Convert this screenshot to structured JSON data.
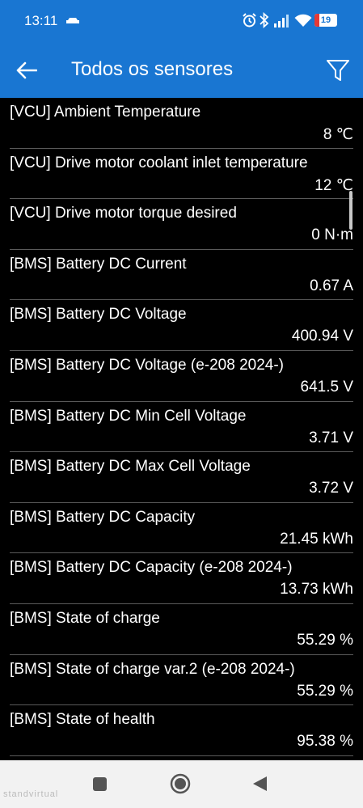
{
  "status_bar": {
    "time": "13:11",
    "battery_level": "19",
    "icons": [
      "car-icon",
      "alarm-icon",
      "bluetooth-icon",
      "signal-icon",
      "wifi-icon",
      "battery-icon"
    ]
  },
  "app_bar": {
    "title": "Todos os sensores",
    "back_icon": "arrow-left-icon",
    "filter_icon": "filter-icon"
  },
  "sensors": [
    {
      "name": "[VCU] Ambient Temperature",
      "value": "8 ℃"
    },
    {
      "name": "[VCU] Drive motor coolant inlet temperature",
      "value": "12 ℃"
    },
    {
      "name": "[VCU] Drive motor torque desired",
      "value": "0 N·m"
    },
    {
      "name": "[BMS] Battery DC Current",
      "value": "0.67 A"
    },
    {
      "name": "[BMS] Battery DC Voltage",
      "value": "400.94 V"
    },
    {
      "name": "[BMS] Battery DC Voltage (e-208 2024-)",
      "value": "641.5 V"
    },
    {
      "name": "[BMS] Battery DC Min Cell Voltage",
      "value": "3.71 V"
    },
    {
      "name": "[BMS] Battery DC Max Cell Voltage",
      "value": "3.72 V"
    },
    {
      "name": "[BMS] Battery DC Capacity",
      "value": "21.45 kWh"
    },
    {
      "name": "[BMS] Battery DC Capacity (e-208 2024-)",
      "value": "13.73 kWh"
    },
    {
      "name": "[BMS] State of charge",
      "value": "55.29 %"
    },
    {
      "name": "[BMS] State of charge var.2 (e-208 2024-)",
      "value": "55.29 %"
    },
    {
      "name": "[BMS] State of health",
      "value": "95.38 %"
    }
  ],
  "nav_bar": {
    "recents_icon": "square-icon",
    "home_icon": "circle-home-icon",
    "back_icon": "triangle-back-icon",
    "watermark": "standvirtual"
  },
  "colors": {
    "primary": "#1976d2",
    "background": "#000000",
    "divider": "#5a5a5a",
    "text": "#ffffff"
  }
}
